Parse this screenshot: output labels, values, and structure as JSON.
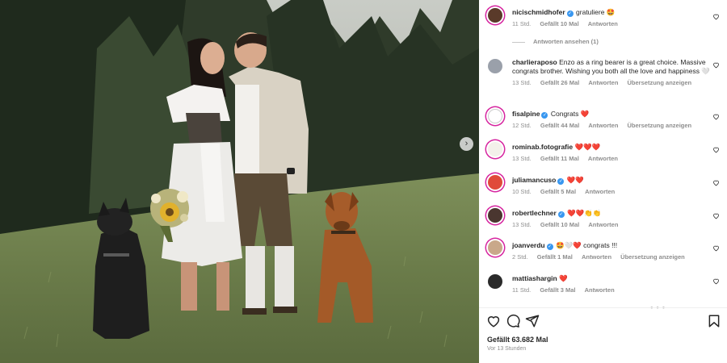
{
  "post": {
    "likes": "Gefällt 63.682 Mal",
    "time_ago": "Vor 13 Stunden"
  },
  "icons": {
    "like": "heart-outline-icon",
    "comment": "comment-bubble-icon",
    "share": "paper-plane-icon",
    "save": "bookmark-icon",
    "next": "chevron-right-icon"
  },
  "colors": {
    "heart_red": "#ed4956",
    "verified_blue": "#3897f0",
    "meta_gray": "#8e8e8e"
  },
  "view_replies": "Antworten ansehen (1)",
  "comments": [
    {
      "user": "nicischmidhofer",
      "verified": true,
      "text": "gratuliere 🤩",
      "time": "11 Std.",
      "likes": "Gefällt 10 Mal",
      "reply": "Antworten",
      "translate": ""
    },
    {
      "user": "charlieraposo",
      "verified": false,
      "text": "Enzo as a ring bearer is a great choice. Massive congrats brother. Wishing you both all the love and happiness 🤍",
      "time": "13 Std.",
      "likes": "Gefällt 26 Mal",
      "reply": "Antworten",
      "translate": "Übersetzung anzeigen"
    },
    {
      "user": "fisalpine",
      "verified": true,
      "text": "Congrats ❤️",
      "time": "12 Std.",
      "likes": "Gefällt 44 Mal",
      "reply": "Antworten",
      "translate": "Übersetzung anzeigen"
    },
    {
      "user": "rominab.fotografie",
      "verified": false,
      "text": "❤️❤️❤️",
      "time": "13 Std.",
      "likes": "Gefällt 11 Mal",
      "reply": "Antworten",
      "translate": ""
    },
    {
      "user": "juliamancuso",
      "verified": true,
      "text": "❤️❤️",
      "time": "10 Std.",
      "likes": "Gefällt 5 Mal",
      "reply": "Antworten",
      "translate": ""
    },
    {
      "user": "robertlechner",
      "verified": true,
      "text": "❤️❤️👏👏",
      "time": "13 Std.",
      "likes": "Gefällt 10 Mal",
      "reply": "Antworten",
      "translate": ""
    },
    {
      "user": "joanverdu",
      "verified": true,
      "text": "🤩🤍❤️ congrats !!!",
      "time": "2 Std.",
      "likes": "Gefällt 1 Mal",
      "reply": "Antworten",
      "translate": "Übersetzung anzeigen"
    },
    {
      "user": "mattiashargin",
      "verified": false,
      "text": "❤️",
      "time": "11 Std.",
      "likes": "Gefällt 3 Mal",
      "reply": "Antworten",
      "translate": ""
    }
  ]
}
